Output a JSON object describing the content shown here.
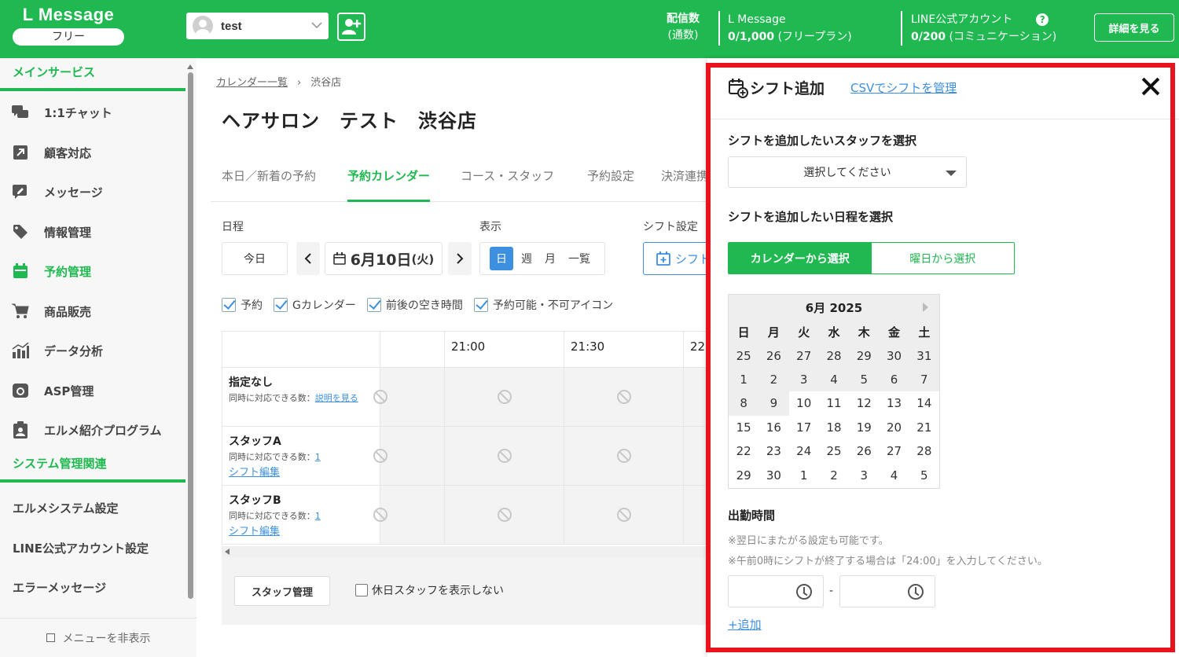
{
  "header": {
    "app_name": "L Message",
    "plan_badge": "フリー",
    "account_name": "test",
    "delivery_label": "配信数",
    "delivery_sub": "(通数)",
    "lmessage_label": "L Message",
    "lmessage_count": "0/1,000",
    "lmessage_plan": "(フリープラン)",
    "line_label": "LINE公式アカウント",
    "line_count": "0/200",
    "line_plan": "(コミュニケーション)",
    "details_button": "詳細を見る"
  },
  "sidebar": {
    "section_main": "メインサービス",
    "items": [
      {
        "label": "1:1チャット",
        "icon": "chat-icon"
      },
      {
        "label": "顧客対応",
        "icon": "external-link-icon"
      },
      {
        "label": "メッセージ",
        "icon": "message-edit-icon"
      },
      {
        "label": "情報管理",
        "icon": "tag-icon"
      },
      {
        "label": "予約管理",
        "icon": "calendar-icon"
      },
      {
        "label": "商品販売",
        "icon": "cart-icon"
      },
      {
        "label": "データ分析",
        "icon": "chart-icon"
      },
      {
        "label": "ASP管理",
        "icon": "asp-icon"
      },
      {
        "label": "エルメ紹介プログラム",
        "icon": "clipboard-user-icon"
      }
    ],
    "section_system": "システム管理関連",
    "system_items": [
      "エルメシステム設定",
      "LINE公式アカウント設定",
      "エラーメッセージ"
    ],
    "hide_menu": "メニューを非表示"
  },
  "main": {
    "breadcrumb_link": "カレンダー一覧",
    "breadcrumb_current": "渋谷店",
    "title": "ヘアサロン　テスト　渋谷店",
    "tabs": [
      "本日／新着の予約",
      "予約カレンダー",
      "コース・スタッフ",
      "予約設定",
      "決済連携"
    ],
    "label_schedule": "日程",
    "label_view": "表示",
    "label_shift": "シフト設定",
    "today_button": "今日",
    "date_main": "6月10日",
    "date_dow": "(火)",
    "view_options": [
      "日",
      "週",
      "月",
      "一覧"
    ],
    "shift_button": "シフト",
    "checkboxes": [
      "予約",
      "Gカレンダー",
      "前後の空き時間",
      "予約可能・不可アイコン"
    ],
    "time_headers": [
      "21:00",
      "21:30",
      "22"
    ],
    "rows": [
      {
        "name": "指定なし",
        "capacity_label": "同時に対応できる数：",
        "capacity_value": "説明を見る",
        "edit": ""
      },
      {
        "name": "スタッフA",
        "capacity_label": "同時に対応できる数：",
        "capacity_value": "1",
        "edit": "シフト編集"
      },
      {
        "name": "スタッフB",
        "capacity_label": "同時に対応できる数：",
        "capacity_value": "1",
        "edit": "シフト編集"
      }
    ],
    "staff_mgmt_button": "スタッフ管理",
    "hide_holiday_label": "休日スタッフを表示しない"
  },
  "panel": {
    "title": "シフト追加",
    "csv_link": "CSVでシフトを管理",
    "staff_section": "シフトを追加したいスタッフを選択",
    "staff_placeholder": "選択してください",
    "date_section": "シフトを追加したい日程を選択",
    "mode_calendar": "カレンダーから選択",
    "mode_weekday": "曜日から選択",
    "calendar_month": "6月 2025",
    "weekdays": [
      "日",
      "月",
      "火",
      "水",
      "木",
      "金",
      "土"
    ],
    "weeks": [
      [
        "25",
        "26",
        "27",
        "28",
        "29",
        "30",
        "31"
      ],
      [
        "1",
        "2",
        "3",
        "4",
        "5",
        "6",
        "7"
      ],
      [
        "8",
        "9",
        "10",
        "11",
        "12",
        "13",
        "14"
      ],
      [
        "15",
        "16",
        "17",
        "18",
        "19",
        "20",
        "21"
      ],
      [
        "22",
        "23",
        "24",
        "25",
        "26",
        "27",
        "28"
      ],
      [
        "29",
        "30",
        "1",
        "2",
        "3",
        "4",
        "5"
      ]
    ],
    "work_time_title": "出勤時間",
    "note_1": "※翌日にまたがる設定も可能です。",
    "note_2": "※午前0時にシフトが終了する場合は「24:00」を入力してください。",
    "time_separator": "-",
    "add_link": "+追加"
  },
  "colors": {
    "brand_green": "#20b850",
    "link_blue": "#3d8fe0",
    "highlight_red": "#e8131c"
  }
}
